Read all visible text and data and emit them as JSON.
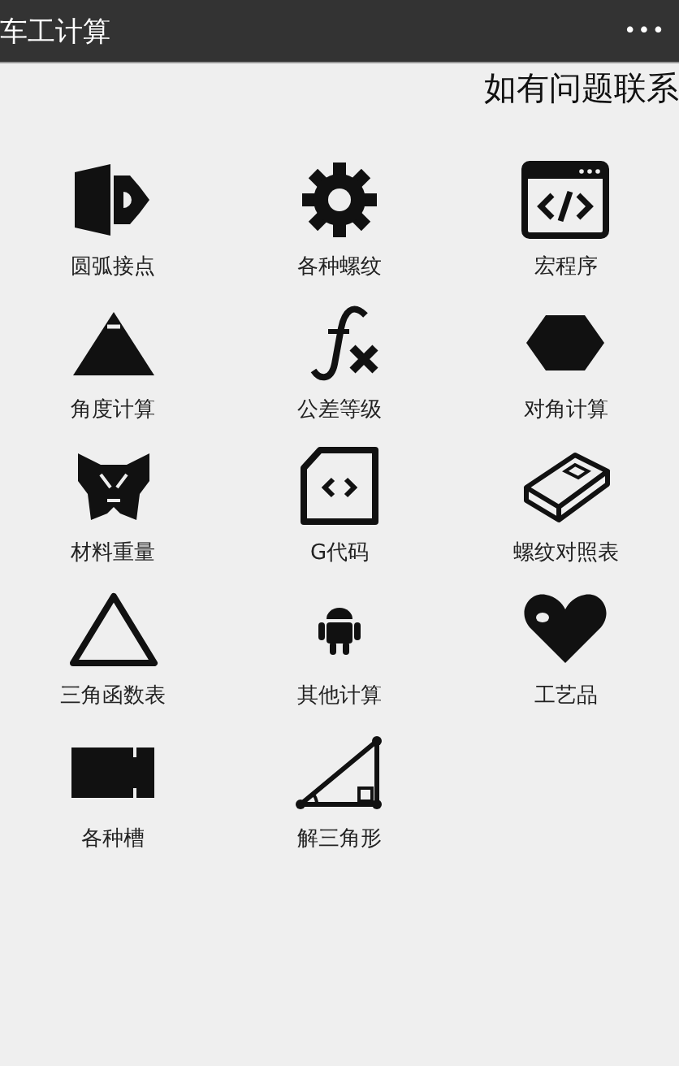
{
  "header": {
    "title": "车工计算",
    "menu": "•••"
  },
  "notice": "如有问题联系",
  "tools": [
    {
      "kind": "document",
      "label": "圆弧接点"
    },
    {
      "kind": "gear",
      "label": "各种螺纹"
    },
    {
      "kind": "code-window",
      "label": "宏程序"
    },
    {
      "kind": "pyramid",
      "label": "角度计算"
    },
    {
      "kind": "function",
      "label": "公差等级"
    },
    {
      "kind": "hexagon",
      "label": "对角计算"
    },
    {
      "kind": "mask",
      "label": "材料重量"
    },
    {
      "kind": "code-file",
      "label": "G代码"
    },
    {
      "kind": "book",
      "label": "螺纹对照表"
    },
    {
      "kind": "triangle",
      "label": "三角函数表"
    },
    {
      "kind": "robot",
      "label": "其他计算"
    },
    {
      "kind": "heart",
      "label": "工艺品"
    },
    {
      "kind": "slot",
      "label": "各种槽"
    },
    {
      "kind": "right-triangle",
      "label": "解三角形"
    }
  ]
}
